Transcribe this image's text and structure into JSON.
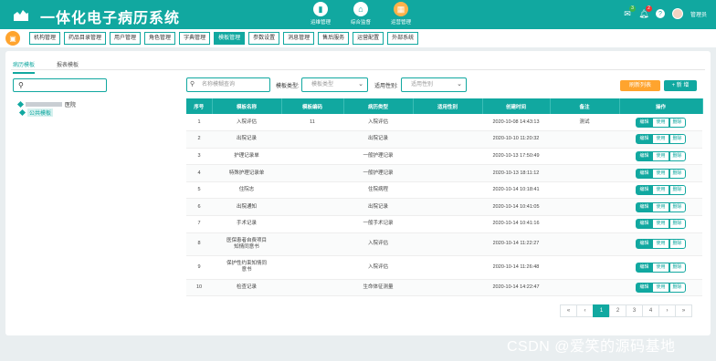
{
  "app": {
    "title": "一体化电子病历系统"
  },
  "topnav": [
    {
      "label": "运维管理",
      "icon": "server-icon"
    },
    {
      "label": "综合监督",
      "icon": "home-icon"
    },
    {
      "label": "运营管理",
      "icon": "grid-icon"
    }
  ],
  "header_right": {
    "mail_badge": "3",
    "bell_badge": "2",
    "user": "管理员"
  },
  "menus": [
    "机构管理",
    "药品目录管理",
    "用户管理",
    "角色管理",
    "字典管理",
    "模板管理",
    "参数设置",
    "消息管理",
    "售后服务",
    "运营配置",
    "外部系统"
  ],
  "active_menu": "模板管理",
  "tabs": [
    "病历模板",
    "报表模板"
  ],
  "tree": {
    "root": "医院",
    "child": "公共模板"
  },
  "filters": {
    "name_placeholder": "名称模糊查询",
    "type_label": "模板类型:",
    "type_placeholder": "模板类型",
    "gender_label": "适用性别:",
    "gender_placeholder": "适用性别"
  },
  "buttons": {
    "refresh": "刷新列表",
    "add": "+ 新 增"
  },
  "table": {
    "headers": [
      "序号",
      "模板名称",
      "模板编码",
      "病历类型",
      "适用性别",
      "创建时间",
      "备注",
      "操作"
    ],
    "rows": [
      [
        "1",
        "入院评估",
        "11",
        "入院评估",
        "",
        "2020-10-08 14:43:13",
        "测试"
      ],
      [
        "2",
        "出院记录",
        "",
        "出院记录",
        "",
        "2020-10-10 11:20:32",
        ""
      ],
      [
        "3",
        "护理记录单",
        "",
        "一般护理记录",
        "",
        "2020-10-13 17:50:49",
        ""
      ],
      [
        "4",
        "特殊护理记录单",
        "",
        "一般护理记录",
        "",
        "2020-10-13 18:11:12",
        ""
      ],
      [
        "5",
        "住院志",
        "",
        "住院病程",
        "",
        "2020-10-14 10:18:41",
        ""
      ],
      [
        "6",
        "出院通知",
        "",
        "出院记录",
        "",
        "2020-10-14 10:41:05",
        ""
      ],
      [
        "7",
        "手术记录",
        "",
        "一般手术记录",
        "",
        "2020-10-14 10:41:16",
        ""
      ],
      [
        "8",
        "医保患者自费项目知情同意书",
        "",
        "入院评估",
        "",
        "2020-10-14 11:22:27",
        ""
      ],
      [
        "9",
        "保护性约束知情同意书",
        "",
        "入院评估",
        "",
        "2020-10-14 11:26:48",
        ""
      ],
      [
        "10",
        "检查记录",
        "",
        "生命体征测量",
        "",
        "2020-10-14 14:22:47",
        ""
      ]
    ],
    "ops": [
      "编辑",
      "使用",
      "删除"
    ]
  },
  "pager": [
    "«",
    "‹",
    "1",
    "2",
    "3",
    "4",
    "›",
    "»"
  ],
  "active_page": "1",
  "watermark": "CSDN @爱笑的源码基地",
  "colors": {
    "primary": "#11a8a0",
    "accent": "#ffa42e"
  }
}
